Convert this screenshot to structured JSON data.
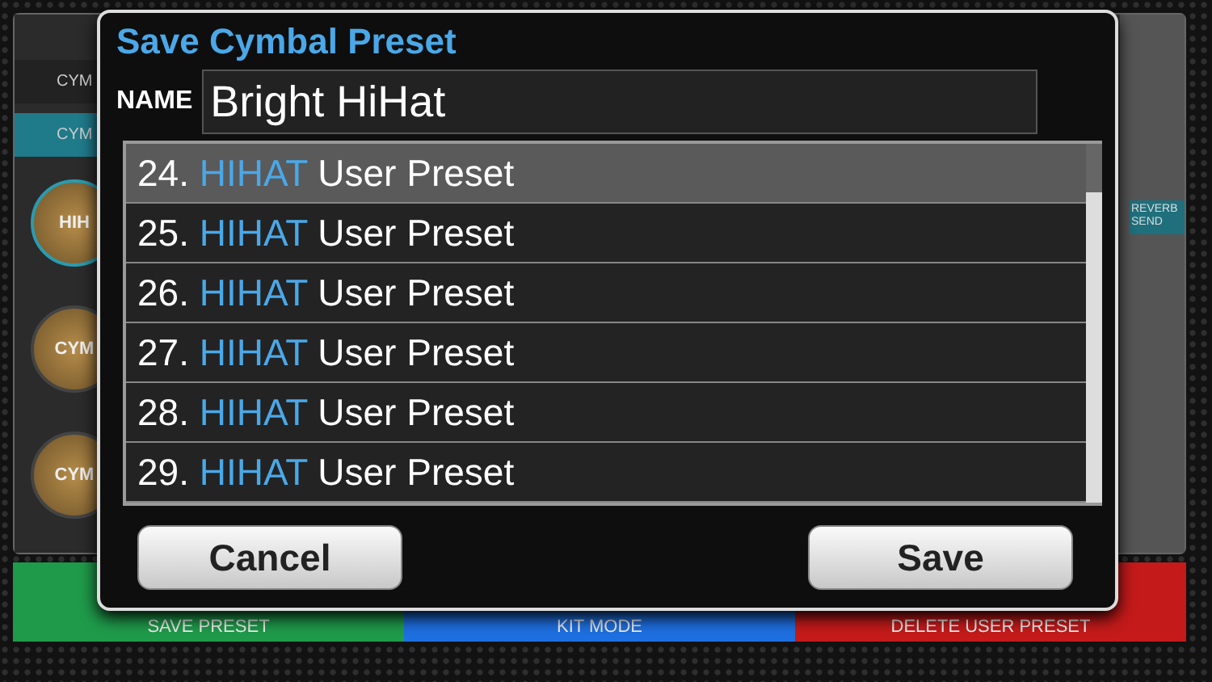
{
  "background": {
    "tabs": [
      {
        "label": "CYM",
        "selected": false
      },
      {
        "label": "CYM",
        "selected": true
      }
    ],
    "pads": [
      {
        "label": "HIH",
        "selected": true
      },
      {
        "label": "CYM",
        "selected": false
      },
      {
        "label": "CYM",
        "selected": false
      }
    ],
    "side_label": "REVERB SEND",
    "bottom_buttons": [
      {
        "label": "SAVE PRESET",
        "color": "#1f9a4a"
      },
      {
        "label": "KIT MODE",
        "color": "#1e6fe0"
      },
      {
        "label": "DELETE USER PRESET",
        "color": "#c41a1a"
      }
    ]
  },
  "dialog": {
    "title": "Save Cymbal Preset",
    "name_label": "NAME",
    "name_value": "Bright HiHat",
    "presets": [
      {
        "number": "24.",
        "category": "HIHAT",
        "name": "User Preset",
        "selected": true
      },
      {
        "number": "25.",
        "category": "HIHAT",
        "name": "User Preset",
        "selected": false
      },
      {
        "number": "26.",
        "category": "HIHAT",
        "name": "User Preset",
        "selected": false
      },
      {
        "number": "27.",
        "category": "HIHAT",
        "name": "User Preset",
        "selected": false
      },
      {
        "number": "28.",
        "category": "HIHAT",
        "name": "User Preset",
        "selected": false
      },
      {
        "number": "29.",
        "category": "HIHAT",
        "name": "User Preset",
        "selected": false
      }
    ],
    "buttons": [
      "Cancel",
      "Save"
    ]
  }
}
